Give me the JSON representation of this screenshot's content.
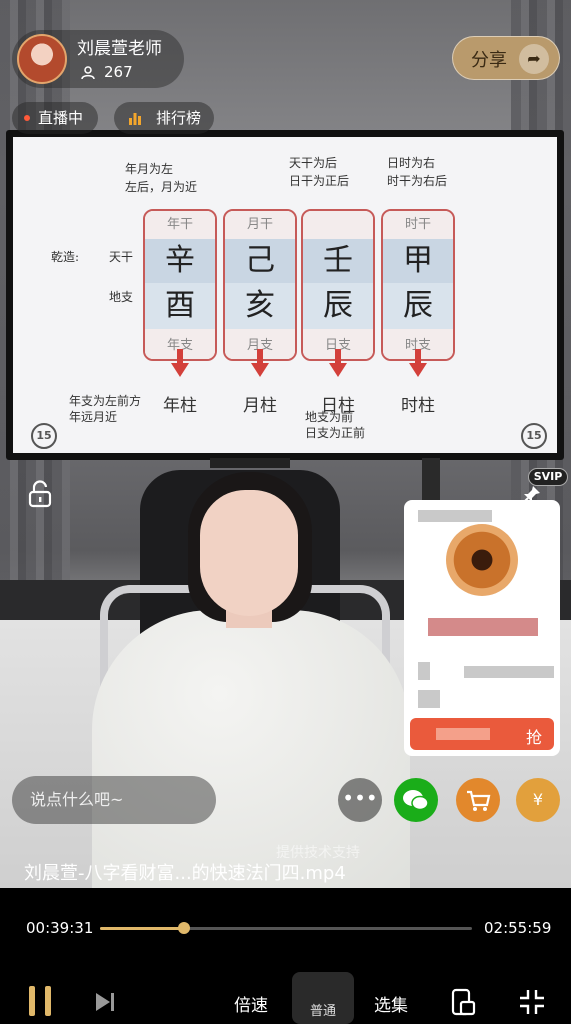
{
  "host": {
    "name": "刘晨萱老师",
    "viewer_count": "267",
    "share_label": "分享",
    "live_label": "直播中",
    "rank_label": "排行榜"
  },
  "slide": {
    "annotations": {
      "year_month_order": "年月为左",
      "left_back": "左后，月为近",
      "day_stem_back": "天干为后",
      "day_stem_right_back": "日干为正后",
      "day_hour_right": "日时为右",
      "hour_stem_right_back": "时干为右后",
      "qianzao": "乾造:",
      "tiangan": "天干",
      "dizhi": "地支",
      "year_branch_front": "年支为左前方",
      "year_far_front": "年远月近",
      "day_branch_front": "地支为前",
      "day_branch_right_front": "日支为正前"
    },
    "pillars": [
      {
        "top": "年干",
        "stem": "辛",
        "branch": "酉",
        "bottom": "年支",
        "name": "年柱"
      },
      {
        "top": "月干",
        "stem": "己",
        "branch": "亥",
        "bottom": "月支",
        "name": "月柱"
      },
      {
        "top": "",
        "stem": "壬",
        "branch": "辰",
        "bottom": "日支",
        "name": "日柱"
      },
      {
        "top": "时干",
        "stem": "甲",
        "branch": "辰",
        "bottom": "时支",
        "name": "时柱"
      }
    ],
    "replay_left": "15",
    "replay_right": "15"
  },
  "svip_label": "SVIP",
  "product": {
    "buy_label": "抢"
  },
  "comment": {
    "placeholder": "说点什么吧~",
    "more_label": "•••",
    "coin_label": "¥"
  },
  "watermark": "提供技术支持",
  "player": {
    "file_title": "刘晨萱-八字看财富...的快速法门四.mp4",
    "current_time": "00:39:31",
    "total_time": "02:55:59",
    "progress": 0.2245,
    "speed_label": "倍速",
    "quality_label": "普通",
    "episodes_label": "选集"
  },
  "colors": {
    "accent": "#e0b86a",
    "pillar_border": "#c65a58",
    "arrow": "#d3403b",
    "wechat": "#1aad19",
    "buy": "#ea5a3c"
  }
}
